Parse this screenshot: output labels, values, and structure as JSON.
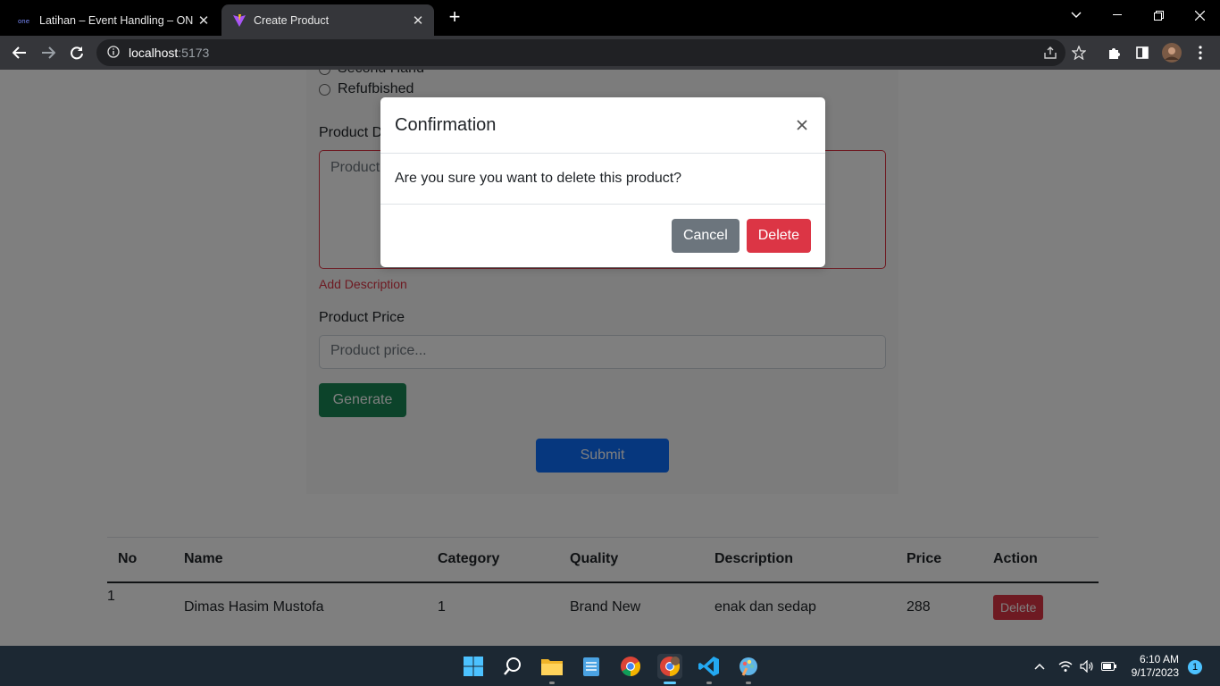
{
  "browser": {
    "tabs": [
      {
        "title": "Latihan – Event Handling – ONE I",
        "active": false
      },
      {
        "title": "Create Product",
        "active": true
      }
    ],
    "url_host": "localhost",
    "url_port": ":5173"
  },
  "form": {
    "radio_partial": "Second Hand",
    "radio_refurbished": "Refufbished",
    "description_label": "Product Description",
    "description_placeholder": "Product",
    "description_feedback": "Add Description",
    "price_label": "Product Price",
    "price_placeholder": "Product price...",
    "generate_label": "Generate",
    "submit_label": "Submit"
  },
  "table": {
    "headers": [
      "No",
      "Name",
      "Category",
      "Quality",
      "Description",
      "Price",
      "Action"
    ],
    "rows": [
      {
        "no": "1",
        "name": "Dimas Hasim Mustofa",
        "category": "1",
        "quality": "Brand New",
        "description": "enak dan sedap",
        "price": "288",
        "action": "Delete"
      }
    ]
  },
  "modal": {
    "title": "Confirmation",
    "body": "Are you sure you want to delete this product?",
    "cancel_label": "Cancel",
    "delete_label": "Delete"
  },
  "taskbar": {
    "apps": [
      "windows-start",
      "search",
      "file-explorer",
      "notepad",
      "chrome",
      "chrome-profile",
      "vscode",
      "paint"
    ],
    "time": "6:10 AM",
    "date": "9/17/2023",
    "notification_count": "1"
  },
  "colors": {
    "danger": "#dc3545",
    "primary": "#0d6efd",
    "success": "#198754",
    "secondary": "#6c757d"
  }
}
